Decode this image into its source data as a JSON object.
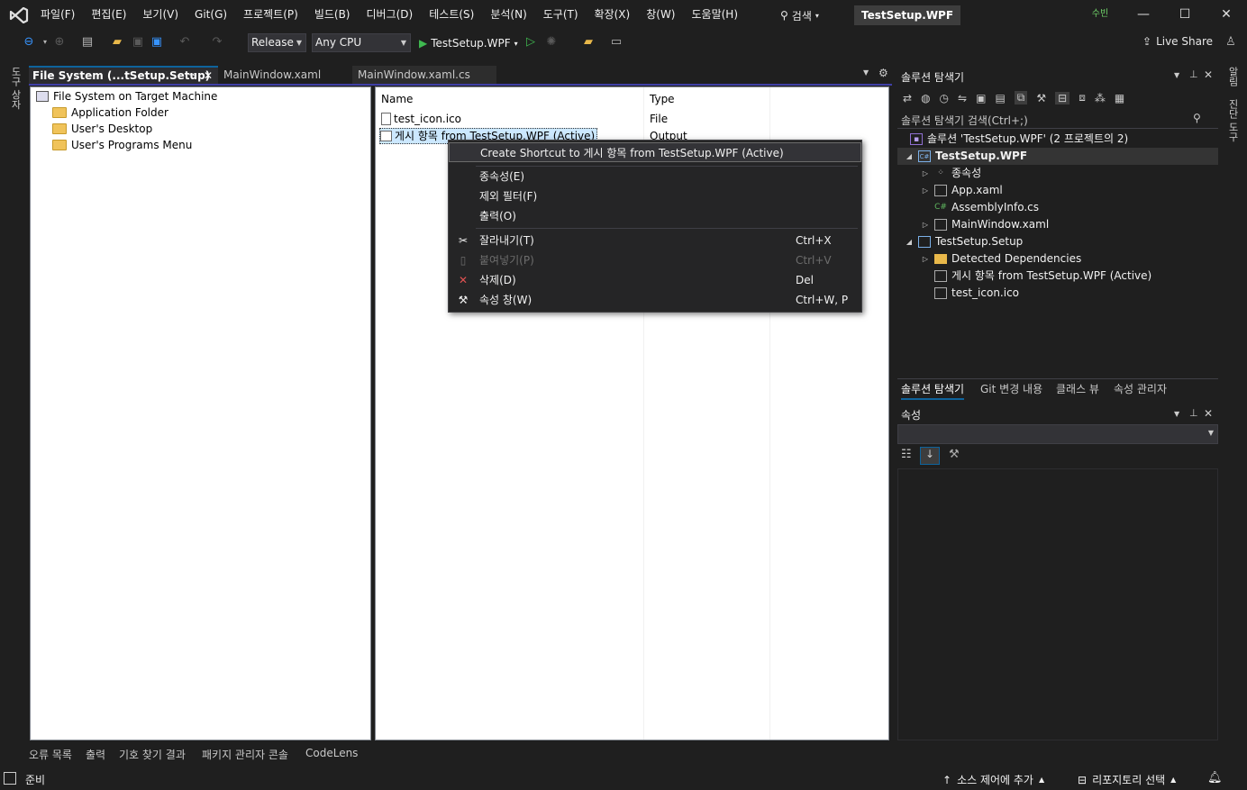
{
  "menu": [
    "파일(F)",
    "편집(E)",
    "보기(V)",
    "Git(G)",
    "프로젝트(P)",
    "빌드(B)",
    "디버그(D)",
    "테스트(S)",
    "분석(N)",
    "도구(T)",
    "확장(X)",
    "창(W)",
    "도움말(H)"
  ],
  "search_label": "검색",
  "solution_name": "TestSetup.WPF",
  "user_badge": "수빈",
  "toolbar": {
    "config": "Release",
    "platform": "Any CPU",
    "startup": "TestSetup.WPF",
    "live_share": "Live Share"
  },
  "left_strip": "도구 상자",
  "right_strip_top": "알림",
  "right_strip_bottom": "진단 도구",
  "tabs": {
    "active": "File System (...tSetup.Setup)",
    "tab2": "MainWindow.xaml",
    "tab3": "MainWindow.xaml.cs"
  },
  "fs_tree": {
    "root": "File System on Target Machine",
    "children": [
      "Application Folder",
      "User's Desktop",
      "User's Programs Menu"
    ]
  },
  "list": {
    "col_name": "Name",
    "col_type": "Type",
    "rows": [
      {
        "name": "test_icon.ico",
        "type": "File"
      },
      {
        "name": "게시 항목 from TestSetup.WPF (Active)",
        "type": "Output"
      }
    ]
  },
  "context_menu": {
    "create_shortcut": "Create Shortcut to 게시 항목 from TestSetup.WPF (Active)",
    "dependencies": "종속성(E)",
    "exclude_filter": "제외 필터(F)",
    "outputs": "출력(O)",
    "cut": "잘라내기(T)",
    "cut_sc": "Ctrl+X",
    "paste": "붙여넣기(P)",
    "paste_sc": "Ctrl+V",
    "delete": "삭제(D)",
    "delete_sc": "Del",
    "properties": "속성 창(W)",
    "properties_sc": "Ctrl+W, P"
  },
  "solution_explorer": {
    "title": "솔루션 탐색기",
    "search_placeholder": "솔루션 탐색기 검색(Ctrl+;)",
    "solution_line": "솔루션 'TestSetup.WPF'  (2 프로젝트의 2)",
    "proj1": "TestSetup.WPF",
    "proj1_items": [
      "종속성",
      "App.xaml",
      "AssemblyInfo.cs",
      "MainWindow.xaml"
    ],
    "proj2": "TestSetup.Setup",
    "proj2_items": [
      "Detected Dependencies",
      "게시 항목 from TestSetup.WPF (Active)",
      "test_icon.ico"
    ],
    "bottom_tabs": [
      "솔루션 탐색기",
      "Git 변경 내용",
      "클래스 뷰",
      "속성 관리자"
    ]
  },
  "properties_panel": {
    "title": "속성"
  },
  "bottom_tool_tabs": [
    "오류 목록",
    "출력",
    "기호 찾기 결과",
    "패키지 관리자 콘솔",
    "CodeLens"
  ],
  "status": {
    "ready": "준비",
    "source_control": "소스 제어에 추가",
    "repository": "리포지토리 선택"
  },
  "colors": {
    "accent": "#0e639c",
    "background": "#1f1f1f",
    "selection": "#cce8ff"
  }
}
